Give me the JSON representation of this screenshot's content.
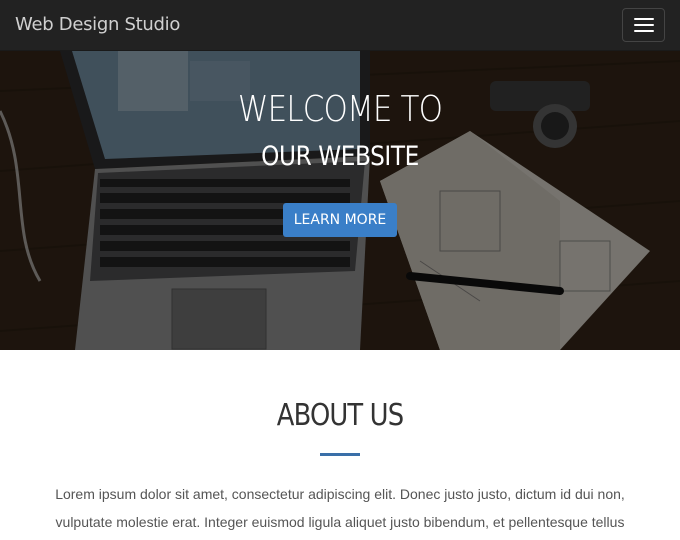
{
  "navbar": {
    "brand": "Web Design Studio",
    "menu_icon": "hamburger-menu-icon"
  },
  "hero": {
    "title_line1": "WELCOME TO",
    "title_line2": "OUR WEBSITE",
    "button_label": "LEARN MORE",
    "button_color": "#3a7fc8"
  },
  "about": {
    "heading": "ABOUT US",
    "accent_color": "#3a6fa8",
    "text_line1": "Lorem ipsum dolor sit amet, consectetur adipiscing elit. Donec justo justo, dictum id dui non,",
    "text_line2": "vulputate molestie erat. Integer euismod ligula aliquet justo bibendum, et pellentesque tellus"
  }
}
